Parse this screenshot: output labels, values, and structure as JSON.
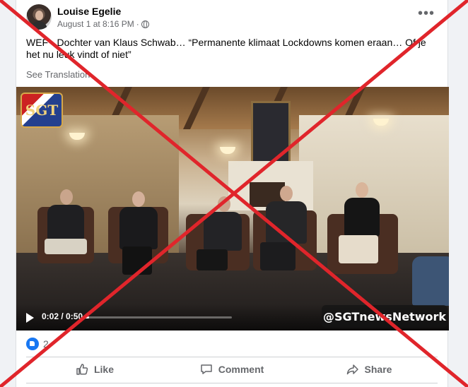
{
  "post": {
    "author": "Louise Egelie",
    "timestamp": "August 1 at 8:16 PM",
    "separator": "·",
    "more_label": "•••",
    "text": "WEF - Dochter van Klaus Schwab… “Permanente klimaat Lockdowns komen eraan… Of je het nu leuk vindt of niet”",
    "see_translation": "See Translation"
  },
  "video": {
    "logo_text": "SGT",
    "time": "0:02 / 0:50",
    "progress": 0.04,
    "watermark": "@SGTnewsNetwork"
  },
  "reactions": {
    "count": "2"
  },
  "actions": {
    "like": "Like",
    "comment": "Comment",
    "share": "Share"
  },
  "overlay": {
    "cross_color": "#e0252b"
  },
  "icons": [
    "globe-icon",
    "more-icon",
    "play-icon",
    "settings-icon",
    "fullscreen-icon",
    "volume-icon",
    "like-reaction-icon",
    "like-icon",
    "comment-icon",
    "share-icon"
  ]
}
